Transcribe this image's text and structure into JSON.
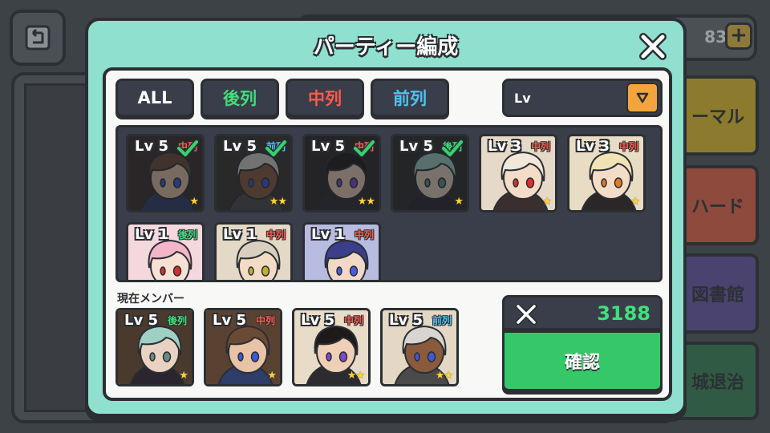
{
  "background": {
    "coin_count": "83",
    "side_buttons": [
      "ーマル",
      "ハード",
      "図書館",
      "城退治"
    ]
  },
  "modal": {
    "title": "パーティー編成"
  },
  "filters": {
    "all": "ALL",
    "back": "後列",
    "middle": "中列",
    "front": "前列"
  },
  "sort": {
    "label": "Lv"
  },
  "roster": [
    {
      "level": "Lv 5",
      "position": "中列",
      "pos_type": "mid",
      "stars": 1,
      "selected": true,
      "hair": "#6b4a35",
      "skin": "#e9c3a6",
      "outfit": "#2f3d6b",
      "eye": "#3a58d8",
      "bg": "#3a2e28"
    },
    {
      "level": "Lv 5",
      "position": "前列",
      "pos_type": "front",
      "stars": 2,
      "selected": true,
      "hair": "#d8d4cf",
      "skin": "#8a5a3d",
      "outfit": "#4a4a4a",
      "eye": "#3a58d8",
      "bg": "#3a3430"
    },
    {
      "level": "Lv 5",
      "position": "中列",
      "pos_type": "mid",
      "stars": 2,
      "selected": true,
      "hair": "#1e1a1a",
      "skin": "#efcfb5",
      "outfit": "#2b2b30",
      "eye": "#7a4ad0",
      "bg": "#2e2724"
    },
    {
      "level": "Lv 5",
      "position": "後列",
      "pos_type": "back",
      "stars": 1,
      "selected": true,
      "hair": "#9fd0c4",
      "skin": "#e9d2c2",
      "outfit": "#2b2530",
      "eye": "#6a8a86",
      "bg": "#2e2a26"
    },
    {
      "level": "Lv 3",
      "position": "中列",
      "pos_type": "mid",
      "stars": 1,
      "selected": false,
      "hair": "#f1e8da",
      "skin": "#f4ddc8",
      "outfit": "#3a2e2e",
      "eye": "#d83030",
      "bg": "#e6d9c8"
    },
    {
      "level": "Lv 3",
      "position": "中列",
      "pos_type": "mid",
      "stars": 1,
      "selected": false,
      "hair": "#f1e3b5",
      "skin": "#f4ddc8",
      "outfit": "#2b2728",
      "eye": "#e07a28",
      "bg": "#e9dcc4"
    },
    {
      "level": "Lv 1",
      "position": "後列",
      "pos_type": "back",
      "stars": 0,
      "selected": false,
      "hair": "#f4b5c9",
      "skin": "#f7e0d4",
      "outfit": "#c64a5a",
      "eye": "#d03030",
      "bg": "#f4d8dd"
    },
    {
      "level": "Lv 1",
      "position": "中列",
      "pos_type": "mid",
      "stars": 0,
      "selected": false,
      "hair": "#d8cfbf",
      "skin": "#f3dcc5",
      "outfit": "#6b5a48",
      "eye": "#c0b030",
      "bg": "#e4d8c6"
    },
    {
      "level": "Lv 1",
      "position": "中列",
      "pos_type": "mid",
      "stars": 0,
      "selected": false,
      "hair": "#3b3e8a",
      "skin": "#f1d8c7",
      "outfit": "#3a3e6a",
      "eye": "#4a5ad8",
      "bg": "#b8bce0"
    }
  ],
  "members_label": "現在メンバー",
  "members": [
    {
      "level": "Lv 5",
      "position": "後列",
      "pos_type": "back",
      "stars": 1,
      "hair": "#9fd0c4",
      "skin": "#e9d2c2",
      "outfit": "#2b2530",
      "eye": "#6a8a86",
      "bg": "#4a3a2e"
    },
    {
      "level": "Lv 5",
      "position": "中列",
      "pos_type": "mid",
      "stars": 1,
      "hair": "#6b4a35",
      "skin": "#e9c3a6",
      "outfit": "#2f3d6b",
      "eye": "#3a58d8",
      "bg": "#5a4232"
    },
    {
      "level": "Lv 5",
      "position": "中列",
      "pos_type": "mid",
      "stars": 2,
      "hair": "#1e1a1a",
      "skin": "#efcfb5",
      "outfit": "#2b2b30",
      "eye": "#7a4ad0",
      "bg": "#e8dcc8"
    },
    {
      "level": "Lv 5",
      "position": "前列",
      "pos_type": "front",
      "stars": 2,
      "hair": "#d8d4cf",
      "skin": "#8a5a3d",
      "outfit": "#4a4a4a",
      "eye": "#3a58d8",
      "bg": "#e4d8c4"
    }
  ],
  "power": {
    "value": "3188"
  },
  "confirm_label": "確認",
  "colors": {
    "teal": "#8fe0cf",
    "green": "#35c768",
    "orange": "#f3a43c"
  }
}
